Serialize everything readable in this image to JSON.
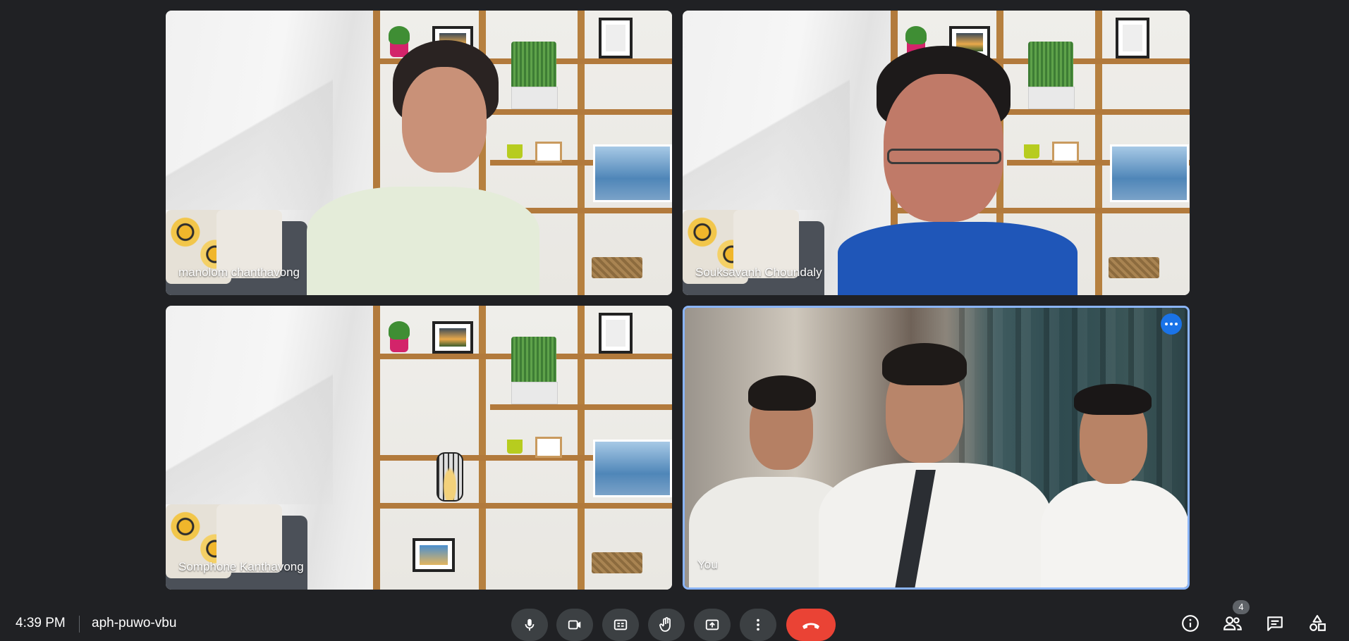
{
  "participants": [
    {
      "name": "manolom chanthavong"
    },
    {
      "name": "Souksavanh Choundaly"
    },
    {
      "name": "Somphone Kanthavong"
    },
    {
      "name": "You"
    }
  ],
  "bottom_bar": {
    "time": "4:39 PM",
    "meeting_code": "aph-puwo-vbu",
    "participant_count": "4"
  },
  "colors": {
    "background": "#202124",
    "control_button": "#3c4043",
    "end_call": "#ea4335",
    "active_speaker_border": "#8ab4f8",
    "more_options": "#1a73e8"
  },
  "icons": [
    "microphone-icon",
    "camera-icon",
    "captions-icon",
    "raise-hand-icon",
    "present-icon",
    "more-vert-icon",
    "end-call-icon",
    "info-icon",
    "people-icon",
    "chat-icon",
    "activities-icon"
  ]
}
